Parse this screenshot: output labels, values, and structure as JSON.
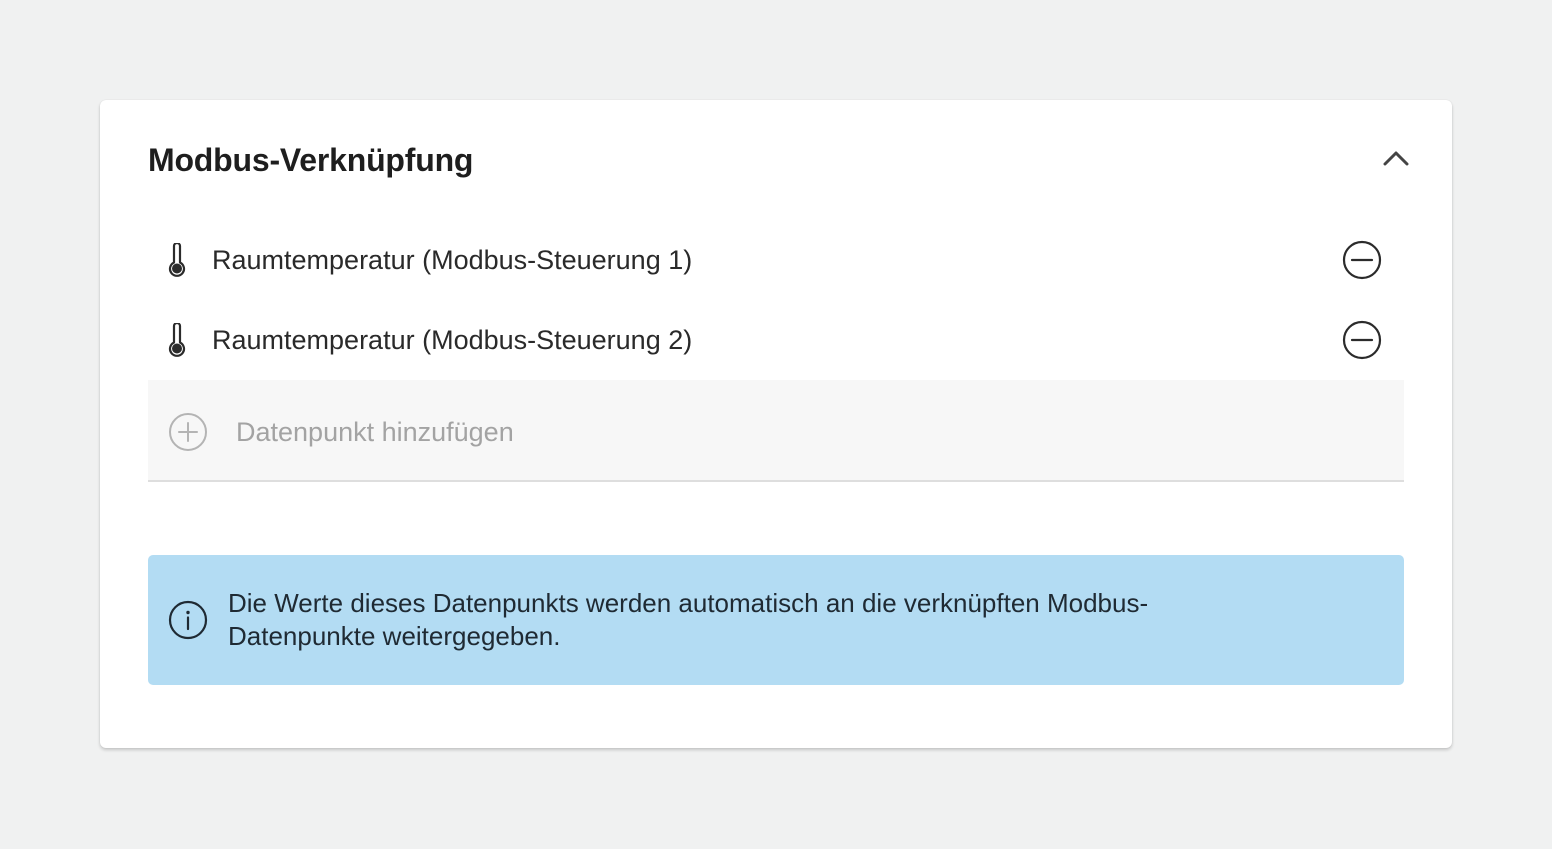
{
  "panel": {
    "title": "Modbus-Verknüpfung",
    "collapse_icon": "chevron-up-icon"
  },
  "linked_datapoints": [
    {
      "icon": "thermometer-icon",
      "label": "Raumtemperatur (Modbus-Steuerung 1)",
      "action_icon": "remove-circle-icon"
    },
    {
      "icon": "thermometer-icon",
      "label": "Raumtemperatur (Modbus-Steuerung 2)",
      "action_icon": "remove-circle-icon"
    }
  ],
  "add_datapoint": {
    "icon": "add-circle-icon",
    "placeholder": "Datenpunkt hinzufügen",
    "value": ""
  },
  "info": {
    "icon": "info-icon",
    "text": "Die Werte dieses Datenpunkts werden automatisch an die verknüpften Modbus-Datenpunkte weitergegeben."
  },
  "colors": {
    "page_background": "#f0f1f1",
    "card_background": "#ffffff",
    "info_background": "#b3dcf3",
    "add_field_background": "#f7f7f7",
    "placeholder_text": "#a3a3a3"
  }
}
